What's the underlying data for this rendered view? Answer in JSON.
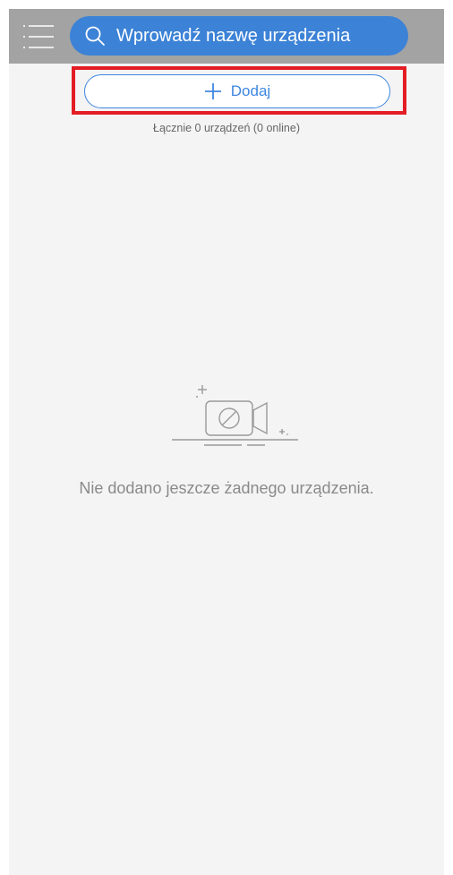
{
  "search": {
    "placeholder": "Wprowadź nazwę urządzenia"
  },
  "toolbar": {
    "add_label": "Dodaj"
  },
  "summary": {
    "text": "Łącznie 0 urządzeń (0 online)"
  },
  "empty_state": {
    "message": "Nie dodano jeszcze żadnego urządzenia."
  },
  "icons": {
    "menu": "menu-icon",
    "search": "search-icon",
    "add": "plus-icon",
    "empty": "camera-off-icon"
  },
  "colors": {
    "top_bar": "#a3a3a3",
    "search_pill": "#3c82d6",
    "accent": "#3f87e0",
    "highlight": "#e41c24",
    "background": "#f4f4f4"
  }
}
